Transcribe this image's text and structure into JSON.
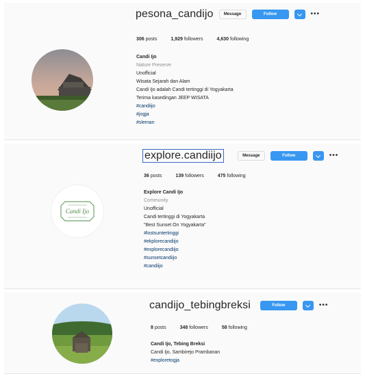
{
  "profiles": [
    {
      "username": "pesona_candijo",
      "message_label": "Message",
      "follow_label": "Follow",
      "more_label": "•••",
      "stats": {
        "posts_count": "306",
        "posts_label": "posts",
        "followers_count": "1,929",
        "followers_label": "followers",
        "following_count": "4,630",
        "following_label": "following"
      },
      "bio": {
        "name": "Candi Ijo",
        "category": "Nature Preserve",
        "lines": [
          "Unofficial",
          "Wisata Sejarah dan Alam",
          "Candi Ijo adalah Candi tertinggi di Yogyakarta",
          "Terima kasedingan JEEP WISATA"
        ],
        "tags": [
          "#candiijo",
          "#jogja",
          "#sleman"
        ]
      }
    },
    {
      "username": "explore.candiijo",
      "message_label": "Message",
      "follow_label": "Follow",
      "more_label": "•••",
      "stats": {
        "posts_count": "36",
        "posts_label": "posts",
        "followers_count": "139",
        "followers_label": "followers",
        "following_count": "475",
        "following_label": "following"
      },
      "bio": {
        "name": "Explore Candi Ijo",
        "category": "Community",
        "lines": [
          "Unofficial",
          "Candi tertinggi di Yogyakarta",
          "\"Best Sunset On Yogyakarta\""
        ],
        "tags": [
          "#lostsuntertinggi",
          "#ekplorecandiijo",
          "#explorecandiijo",
          "#sunsetcandiijo",
          "#candiijo"
        ]
      },
      "logo_text": "Candi Ijo"
    },
    {
      "username": "candijo_tebingbreksi",
      "follow_label": "Follow",
      "more_label": "•••",
      "stats": {
        "posts_count": "8",
        "posts_label": "posts",
        "followers_count": "348",
        "followers_label": "followers",
        "following_count": "58",
        "following_label": "following"
      },
      "bio": {
        "name": "Candi Ijo, Tebing Breksi",
        "lines": [
          "Candi Ijo, Sambirejo Prambanan"
        ],
        "tags": [
          "#exploretogja"
        ]
      }
    }
  ],
  "colors": {
    "follow": "#3897f0",
    "text": "#262626",
    "muted": "#8e8e8e",
    "tag": "#00376b",
    "background": "#fafafa"
  }
}
